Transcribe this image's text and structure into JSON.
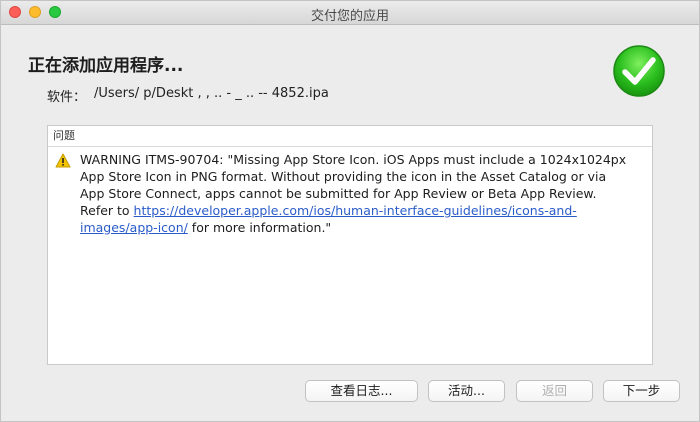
{
  "window": {
    "title": "交付您的应用"
  },
  "header": {
    "heading": "正在添加应用程序...",
    "file_label": "软件：",
    "file_path": "/Users/  p/Deskt  ,   ,  ..  -  _  ..  -- 4852.ipa"
  },
  "issues": {
    "column_header": "问题",
    "items": [
      {
        "icon": "warning-icon",
        "text_before": "WARNING ITMS-90704: \"Missing App Store Icon. iOS Apps must include a 1024x1024px App Store Icon in PNG format. Without providing the icon in the Asset Catalog or via App Store Connect, apps cannot be submitted for App Review or Beta App Review. Refer to ",
        "link": "https://developer.apple.com/ios/human-interface-guidelines/icons-and-images/app-icon/",
        "text_after": " for more information.\""
      }
    ]
  },
  "buttons": {
    "view_log": "查看日志...",
    "activity": "活动...",
    "back": "返回",
    "next": "下一步"
  },
  "colors": {
    "success_green": "#2bbf1f",
    "link_blue": "#2a5cc9",
    "warning_yellow": "#f5c400"
  }
}
